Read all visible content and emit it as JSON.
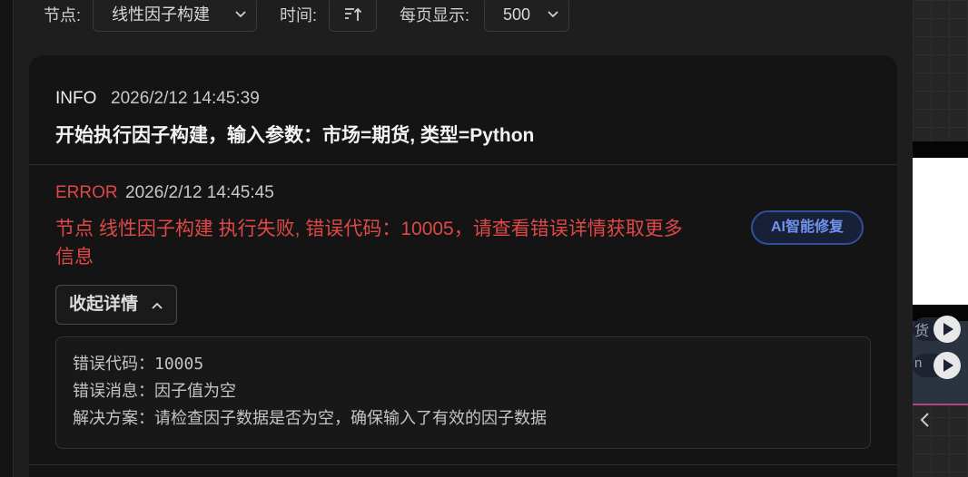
{
  "toolbar": {
    "node_label": "节点:",
    "node_value": "线性因子构建",
    "time_label": "时间:",
    "page_size_label": "每页显示:",
    "page_size_value": "500"
  },
  "logs": [
    {
      "level": "INFO",
      "timestamp": "2026/2/12 14:45:39",
      "message": "开始执行因子构建，输入参数：市场=期货, 类型=Python"
    },
    {
      "level": "ERROR",
      "timestamp": "2026/2/12 14:45:45",
      "message_line1": "节点 线性因子构建 执行失败, 错误代码：10005，请查看错误详情获取更多",
      "message_line2": "信息",
      "ai_fix_label": "AI智能修复",
      "collapse_label": "收起详情",
      "details": [
        "错误代码：10005",
        "错误消息：因子值为空",
        "解决方案：请检查因子数据是否为空，确保输入了有效的因子数据"
      ]
    }
  ],
  "side_panel": {
    "node_fragment_1": "货",
    "node_fragment_2": "n"
  },
  "colors": {
    "info": "#f0f0f0",
    "error": "#e04848",
    "accent": "#6f93ee"
  }
}
